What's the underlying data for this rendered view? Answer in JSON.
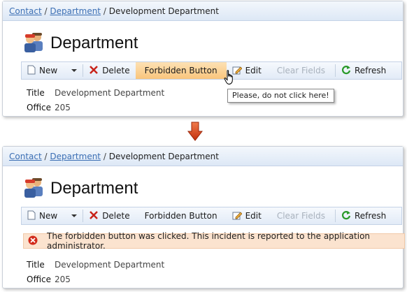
{
  "top": {
    "breadcrumb": {
      "link1": "Contact",
      "sep1": "/",
      "link2": "Department",
      "sep2": "/",
      "current": "Development Department"
    },
    "title": "Department",
    "toolbar": {
      "new_label": "New",
      "delete_label": "Delete",
      "forbidden_label": "Forbidden Button",
      "edit_label": "Edit",
      "clear_label": "Clear Fields",
      "refresh_label": "Refresh"
    },
    "tooltip": "Please, do not click here!",
    "fields": {
      "title_label": "Title",
      "title_value": "Development Department",
      "office_label": "Office",
      "office_value": "205"
    }
  },
  "bottom": {
    "breadcrumb": {
      "link1": "Contact",
      "sep1": "/",
      "link2": "Department",
      "sep2": "/",
      "current": "Development Department"
    },
    "title": "Department",
    "toolbar": {
      "new_label": "New",
      "delete_label": "Delete",
      "forbidden_label": "Forbidden Button",
      "edit_label": "Edit",
      "clear_label": "Clear Fields",
      "refresh_label": "Refresh"
    },
    "error_message": "The forbidden button was clicked. This incident is reported to the application administrator.",
    "fields": {
      "title_label": "Title",
      "title_value": "Development Department",
      "office_label": "Office",
      "office_value": "205"
    }
  },
  "colors": {
    "accent": "#3c6fb4",
    "hover": "#f9c57c",
    "error_bg": "#fbe3cf",
    "arrow": "#d9401c"
  }
}
